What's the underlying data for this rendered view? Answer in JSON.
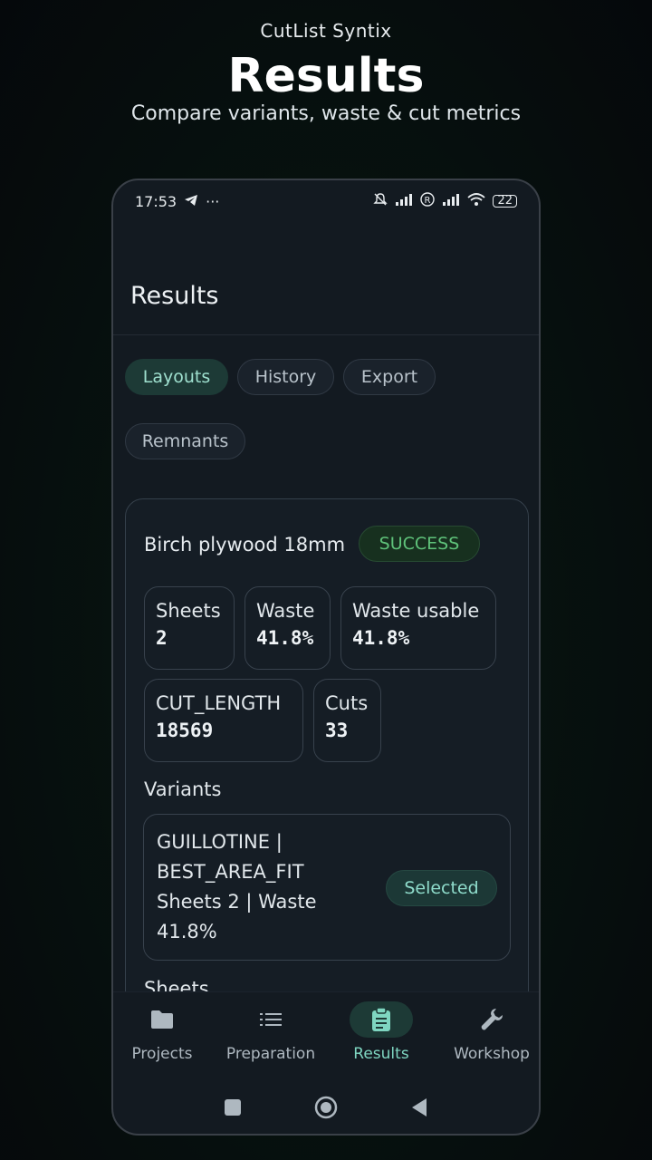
{
  "hero": {
    "brand": "CutList Syntix",
    "title": "Results",
    "subtitle": "Compare variants, waste & cut metrics"
  },
  "status_bar": {
    "time": "17:53",
    "battery": "22"
  },
  "app": {
    "title": "Results"
  },
  "tabs": [
    {
      "label": "Layouts",
      "active": true
    },
    {
      "label": "History",
      "active": false
    },
    {
      "label": "Export",
      "active": false
    },
    {
      "label": "Remnants",
      "active": false
    }
  ],
  "result_card": {
    "material": "Birch plywood 18mm",
    "status": "SUCCESS",
    "metrics": [
      {
        "label": "Sheets",
        "value": "2"
      },
      {
        "label": "Waste",
        "value": "41.8%"
      },
      {
        "label": "Waste usable",
        "value": "41.8%"
      },
      {
        "label": "CUT_LENGTH",
        "value": "18569"
      },
      {
        "label": "Cuts",
        "value": "33"
      }
    ],
    "variants_label": "Variants",
    "variants": [
      {
        "line1": "GUILLOTINE |",
        "line2": "BEST_AREA_FIT",
        "line3": "Sheets 2 | Waste",
        "line4": "41.8%",
        "badge": "Selected"
      }
    ],
    "sheets_label": "Sheets"
  },
  "bottom_nav": [
    {
      "label": "Projects",
      "icon": "folder-icon",
      "active": false
    },
    {
      "label": "Preparation",
      "icon": "list-icon",
      "active": false
    },
    {
      "label": "Results",
      "icon": "clipboard-icon",
      "active": true
    },
    {
      "label": "Workshop",
      "icon": "wrench-icon",
      "active": false
    }
  ],
  "colors": {
    "accent": "#7fd6c1",
    "success": "#5fc27a",
    "background": "#131a21"
  }
}
